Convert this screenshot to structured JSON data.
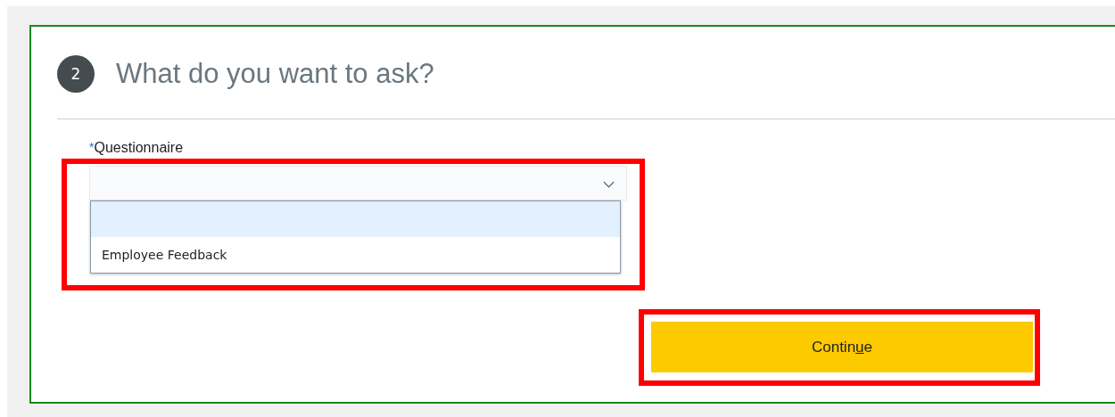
{
  "step": {
    "number": "2",
    "title": "What do you want to ask?"
  },
  "questionnaire": {
    "required_mark": "*",
    "label": "Questionnaire",
    "expanded": true,
    "highlighted_by_frame": true,
    "options": [
      {
        "highlighted": true
      },
      {
        "label": "Employee Feedback",
        "highlighted": false
      }
    ]
  },
  "continue_button": {
    "label_before_access_key": "Contin",
    "access_key": "u",
    "label_after_access_key": "e",
    "highlighted_by_frame": true
  }
}
